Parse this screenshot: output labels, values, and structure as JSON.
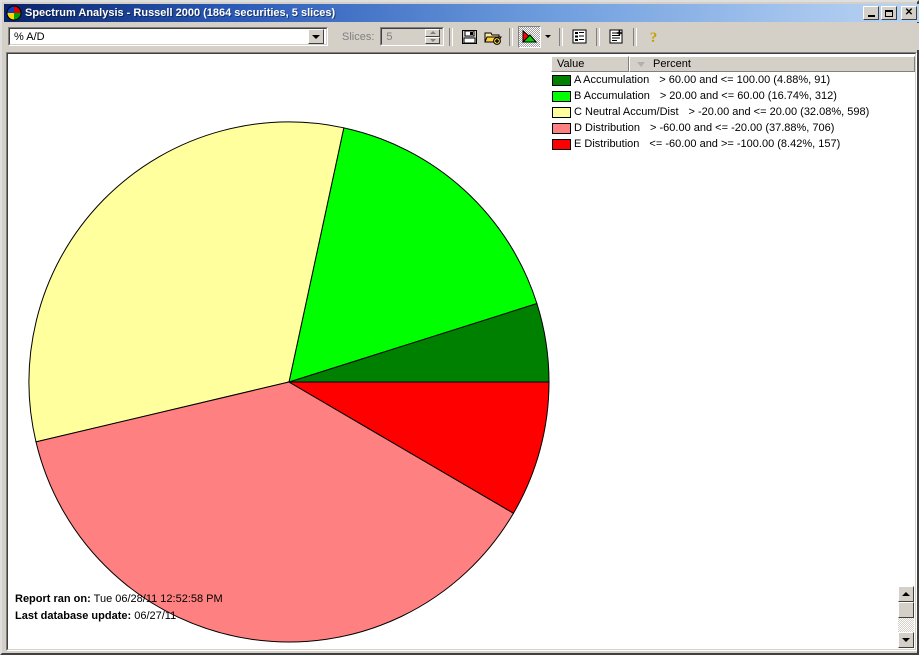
{
  "window": {
    "title": "Spectrum Analysis - Russell 2000 (1864 securities, 5 slices)",
    "icon": "pie-chart-icon",
    "minimize_label": "Minimize",
    "maximize_label": "Maximize",
    "close_label": "Close"
  },
  "toolbar": {
    "field_combo_value": "% A/D",
    "field_combo_placeholder": "% A/D",
    "slices_label": "Slices:",
    "slices_value": "5",
    "buttons": [
      {
        "name": "save-icon",
        "label": "Save"
      },
      {
        "name": "open-add-icon",
        "label": "Open"
      },
      {
        "name": "pie-chart-view-icon",
        "label": "Chart View"
      },
      {
        "name": "chart-type-dropdown-icon",
        "label": "Chart Type"
      },
      {
        "name": "list-report-icon",
        "label": "Report"
      },
      {
        "name": "detail-report-icon",
        "label": "Detail Report"
      },
      {
        "name": "help-icon",
        "label": "Help"
      }
    ]
  },
  "legend": {
    "columns": [
      "Value",
      "Percent"
    ],
    "sort_indicator": "descending",
    "rows": [
      {
        "color": "#008000",
        "label": "A Accumulation",
        "range": "> 60.00 and <= 100.00 (4.88%, 91)"
      },
      {
        "color": "#00ff00",
        "label": "B Accumulation",
        "range": "> 20.00 and <= 60.00 (16.74%, 312)"
      },
      {
        "color": "#ffff9e",
        "label": "C Neutral Accum/Dist",
        "range": "> -20.00 and <= 20.00 (32.08%, 598)"
      },
      {
        "color": "#ff8080",
        "label": "D Distribution",
        "range": "> -60.00 and <= -20.00 (37.88%, 706)"
      },
      {
        "color": "#ff0000",
        "label": "E Distribution",
        "range": "<= -60.00 and >= -100.00 (8.42%, 157)"
      }
    ]
  },
  "footer": {
    "report_ran_label": "Report ran on:",
    "report_ran_value": "Tue 06/28/11 12:52:58 PM",
    "last_update_label": "Last database update:",
    "last_update_value": "06/27/11"
  },
  "chart_data": {
    "type": "pie",
    "title": "Spectrum Analysis - Russell 2000",
    "total_securities": 1864,
    "slice_count": 5,
    "start_angle_deg": 0,
    "direction": "counterclockwise",
    "center": [
      281,
      328
    ],
    "radius": 260,
    "categories": [
      "A Accumulation",
      "B Accumulation",
      "C Neutral Accum/Dist",
      "D Distribution",
      "E Distribution"
    ],
    "values": [
      4.88,
      16.74,
      32.08,
      37.88,
      8.42
    ],
    "counts": [
      91,
      312,
      598,
      706,
      157
    ],
    "colors": [
      "#008000",
      "#00ff00",
      "#ffff9e",
      "#ff8080",
      "#ff0000"
    ],
    "ranges": [
      "> 60.00 and <= 100.00",
      "> 20.00 and <= 60.00",
      "> -20.00 and <= 20.00",
      "> -60.00 and <= -20.00",
      "<= -60.00 and >= -100.00"
    ],
    "xlabel": "",
    "ylabel": "",
    "legend_position": "right"
  }
}
